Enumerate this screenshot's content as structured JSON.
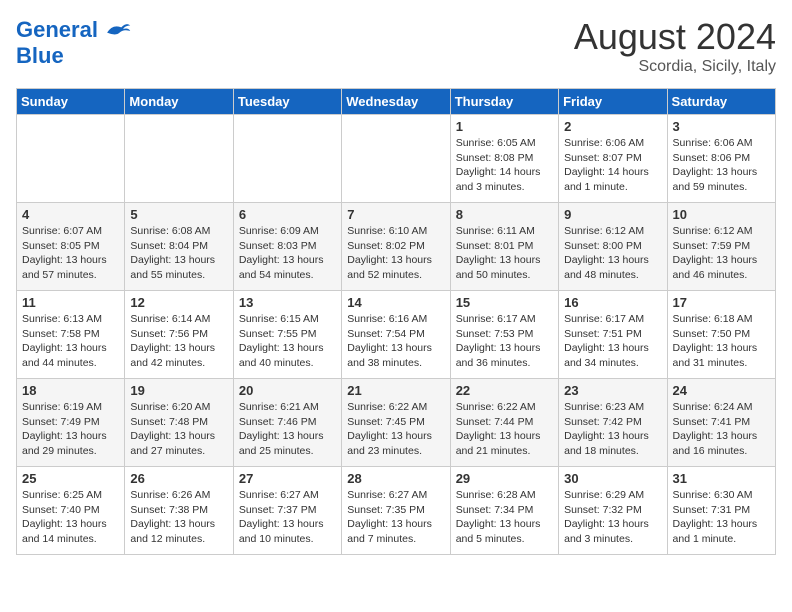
{
  "header": {
    "logo_line1": "General",
    "logo_line2": "Blue",
    "month_year": "August 2024",
    "location": "Scordia, Sicily, Italy"
  },
  "days_of_week": [
    "Sunday",
    "Monday",
    "Tuesday",
    "Wednesday",
    "Thursday",
    "Friday",
    "Saturday"
  ],
  "weeks": [
    [
      {
        "day": "",
        "info": ""
      },
      {
        "day": "",
        "info": ""
      },
      {
        "day": "",
        "info": ""
      },
      {
        "day": "",
        "info": ""
      },
      {
        "day": "1",
        "info": "Sunrise: 6:05 AM\nSunset: 8:08 PM\nDaylight: 14 hours\nand 3 minutes."
      },
      {
        "day": "2",
        "info": "Sunrise: 6:06 AM\nSunset: 8:07 PM\nDaylight: 14 hours\nand 1 minute."
      },
      {
        "day": "3",
        "info": "Sunrise: 6:06 AM\nSunset: 8:06 PM\nDaylight: 13 hours\nand 59 minutes."
      }
    ],
    [
      {
        "day": "4",
        "info": "Sunrise: 6:07 AM\nSunset: 8:05 PM\nDaylight: 13 hours\nand 57 minutes."
      },
      {
        "day": "5",
        "info": "Sunrise: 6:08 AM\nSunset: 8:04 PM\nDaylight: 13 hours\nand 55 minutes."
      },
      {
        "day": "6",
        "info": "Sunrise: 6:09 AM\nSunset: 8:03 PM\nDaylight: 13 hours\nand 54 minutes."
      },
      {
        "day": "7",
        "info": "Sunrise: 6:10 AM\nSunset: 8:02 PM\nDaylight: 13 hours\nand 52 minutes."
      },
      {
        "day": "8",
        "info": "Sunrise: 6:11 AM\nSunset: 8:01 PM\nDaylight: 13 hours\nand 50 minutes."
      },
      {
        "day": "9",
        "info": "Sunrise: 6:12 AM\nSunset: 8:00 PM\nDaylight: 13 hours\nand 48 minutes."
      },
      {
        "day": "10",
        "info": "Sunrise: 6:12 AM\nSunset: 7:59 PM\nDaylight: 13 hours\nand 46 minutes."
      }
    ],
    [
      {
        "day": "11",
        "info": "Sunrise: 6:13 AM\nSunset: 7:58 PM\nDaylight: 13 hours\nand 44 minutes."
      },
      {
        "day": "12",
        "info": "Sunrise: 6:14 AM\nSunset: 7:56 PM\nDaylight: 13 hours\nand 42 minutes."
      },
      {
        "day": "13",
        "info": "Sunrise: 6:15 AM\nSunset: 7:55 PM\nDaylight: 13 hours\nand 40 minutes."
      },
      {
        "day": "14",
        "info": "Sunrise: 6:16 AM\nSunset: 7:54 PM\nDaylight: 13 hours\nand 38 minutes."
      },
      {
        "day": "15",
        "info": "Sunrise: 6:17 AM\nSunset: 7:53 PM\nDaylight: 13 hours\nand 36 minutes."
      },
      {
        "day": "16",
        "info": "Sunrise: 6:17 AM\nSunset: 7:51 PM\nDaylight: 13 hours\nand 34 minutes."
      },
      {
        "day": "17",
        "info": "Sunrise: 6:18 AM\nSunset: 7:50 PM\nDaylight: 13 hours\nand 31 minutes."
      }
    ],
    [
      {
        "day": "18",
        "info": "Sunrise: 6:19 AM\nSunset: 7:49 PM\nDaylight: 13 hours\nand 29 minutes."
      },
      {
        "day": "19",
        "info": "Sunrise: 6:20 AM\nSunset: 7:48 PM\nDaylight: 13 hours\nand 27 minutes."
      },
      {
        "day": "20",
        "info": "Sunrise: 6:21 AM\nSunset: 7:46 PM\nDaylight: 13 hours\nand 25 minutes."
      },
      {
        "day": "21",
        "info": "Sunrise: 6:22 AM\nSunset: 7:45 PM\nDaylight: 13 hours\nand 23 minutes."
      },
      {
        "day": "22",
        "info": "Sunrise: 6:22 AM\nSunset: 7:44 PM\nDaylight: 13 hours\nand 21 minutes."
      },
      {
        "day": "23",
        "info": "Sunrise: 6:23 AM\nSunset: 7:42 PM\nDaylight: 13 hours\nand 18 minutes."
      },
      {
        "day": "24",
        "info": "Sunrise: 6:24 AM\nSunset: 7:41 PM\nDaylight: 13 hours\nand 16 minutes."
      }
    ],
    [
      {
        "day": "25",
        "info": "Sunrise: 6:25 AM\nSunset: 7:40 PM\nDaylight: 13 hours\nand 14 minutes."
      },
      {
        "day": "26",
        "info": "Sunrise: 6:26 AM\nSunset: 7:38 PM\nDaylight: 13 hours\nand 12 minutes."
      },
      {
        "day": "27",
        "info": "Sunrise: 6:27 AM\nSunset: 7:37 PM\nDaylight: 13 hours\nand 10 minutes."
      },
      {
        "day": "28",
        "info": "Sunrise: 6:27 AM\nSunset: 7:35 PM\nDaylight: 13 hours\nand 7 minutes."
      },
      {
        "day": "29",
        "info": "Sunrise: 6:28 AM\nSunset: 7:34 PM\nDaylight: 13 hours\nand 5 minutes."
      },
      {
        "day": "30",
        "info": "Sunrise: 6:29 AM\nSunset: 7:32 PM\nDaylight: 13 hours\nand 3 minutes."
      },
      {
        "day": "31",
        "info": "Sunrise: 6:30 AM\nSunset: 7:31 PM\nDaylight: 13 hours\nand 1 minute."
      }
    ]
  ]
}
